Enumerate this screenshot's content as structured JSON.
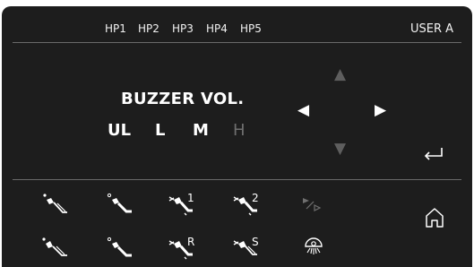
{
  "header": {
    "hp_tabs": [
      "HP1",
      "HP2",
      "HP3",
      "HP4",
      "HP5"
    ],
    "user": "USER A"
  },
  "buzzer": {
    "title": "BUZZER VOL.",
    "levels": [
      "UL",
      "L",
      "M",
      "H"
    ],
    "selected_levels": [
      "UL",
      "L",
      "M"
    ],
    "disabled_levels": [
      "H"
    ]
  },
  "dpad": {
    "up": "up-arrow-icon",
    "left": "left-arrow-icon",
    "right": "right-arrow-icon",
    "down": "down-arrow-icon",
    "enter": "enter-icon"
  },
  "icon_row_1": {
    "labels": [
      "",
      "",
      "1",
      "2",
      ""
    ],
    "names": [
      "instrument-icon-1",
      "instrument-icon-2",
      "instrument-icon-3",
      "instrument-icon-4",
      "play-step-icon"
    ]
  },
  "icon_row_2": {
    "labels": [
      "",
      "",
      "R",
      "S",
      ""
    ],
    "names": [
      "instrument-icon-5",
      "instrument-icon-6",
      "instrument-icon-7",
      "instrument-icon-8",
      "light-icon"
    ]
  },
  "home": "home-icon",
  "colors": {
    "panel": "#1d1d1d",
    "text": "#ffffff",
    "disabled": "#6f6f6f",
    "divider": "#6a6a6a"
  }
}
